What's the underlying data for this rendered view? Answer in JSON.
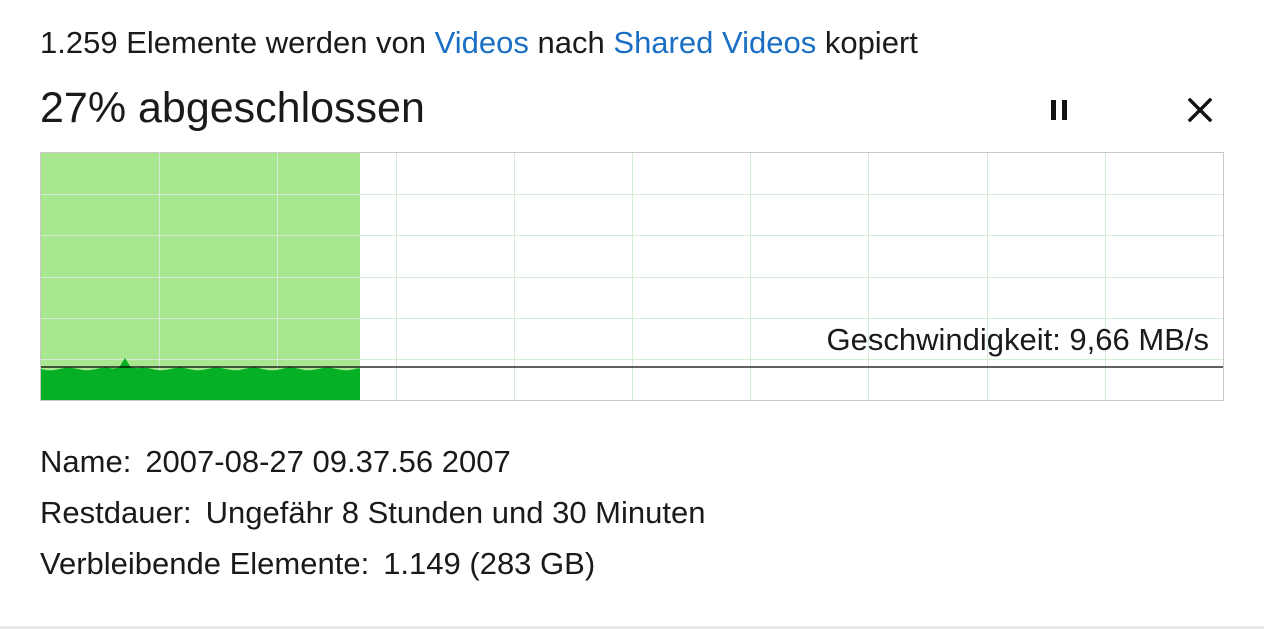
{
  "header": {
    "prefix": "1.259 Elemente werden von",
    "source": "Videos",
    "middle": "nach",
    "destination": "Shared Videos",
    "suffix": "kopiert"
  },
  "progress": {
    "status_text": "27% abgeschlossen",
    "fraction": 0.27
  },
  "controls": {
    "pause_icon": "pause-icon",
    "close_icon": "close-icon"
  },
  "graph": {
    "speed_label": "Geschwindigkeit: 9,66 MB/s",
    "colors": {
      "progress_fill": "#a8e68f",
      "speed_fill": "#06b025",
      "grid": "#d4ecd4",
      "speed_line": "#000000",
      "border": "#c8c8c8"
    }
  },
  "details": {
    "name_label": "Name:",
    "name_value": "2007-08-27 09.37.56 2007",
    "remaining_time_label": "Restdauer:",
    "remaining_time_value": "Ungefähr 8 Stunden und 30 Minuten",
    "remaining_items_label": "Verbleibende Elemente:",
    "remaining_items_value": "1.149 (283 GB)"
  },
  "colors": {
    "link": "#1a6fc4",
    "text": "#1a1a1a"
  }
}
